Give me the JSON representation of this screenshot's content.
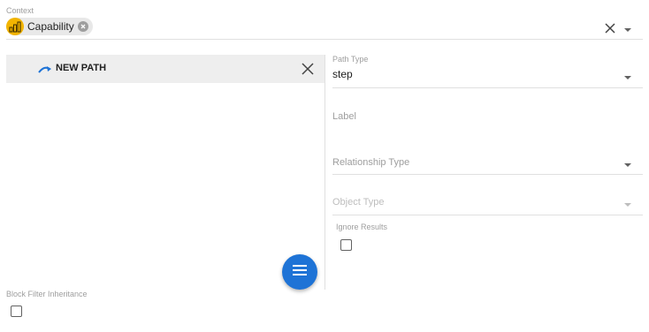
{
  "context": {
    "label": "Context",
    "chip_label": "Capability",
    "chip_icon": "capability-grid-icon",
    "colors": {
      "chip_avatar": "#f2b400"
    }
  },
  "path_panel": {
    "title": "NEW PATH",
    "icon": "redo-arrow-icon",
    "colors": {
      "icon": "#1e73d6",
      "fab": "#1e73d6"
    }
  },
  "block_filter": {
    "label": "Block Filter Inheritance",
    "checked": false
  },
  "form": {
    "path_type": {
      "label": "Path Type",
      "value": "step"
    },
    "label_field": {
      "placeholder": "Label"
    },
    "relationship_type": {
      "placeholder": "Relationship Type"
    },
    "object_type": {
      "placeholder": "Object Type"
    },
    "ignore_results": {
      "label": "Ignore Results",
      "checked": false
    }
  }
}
